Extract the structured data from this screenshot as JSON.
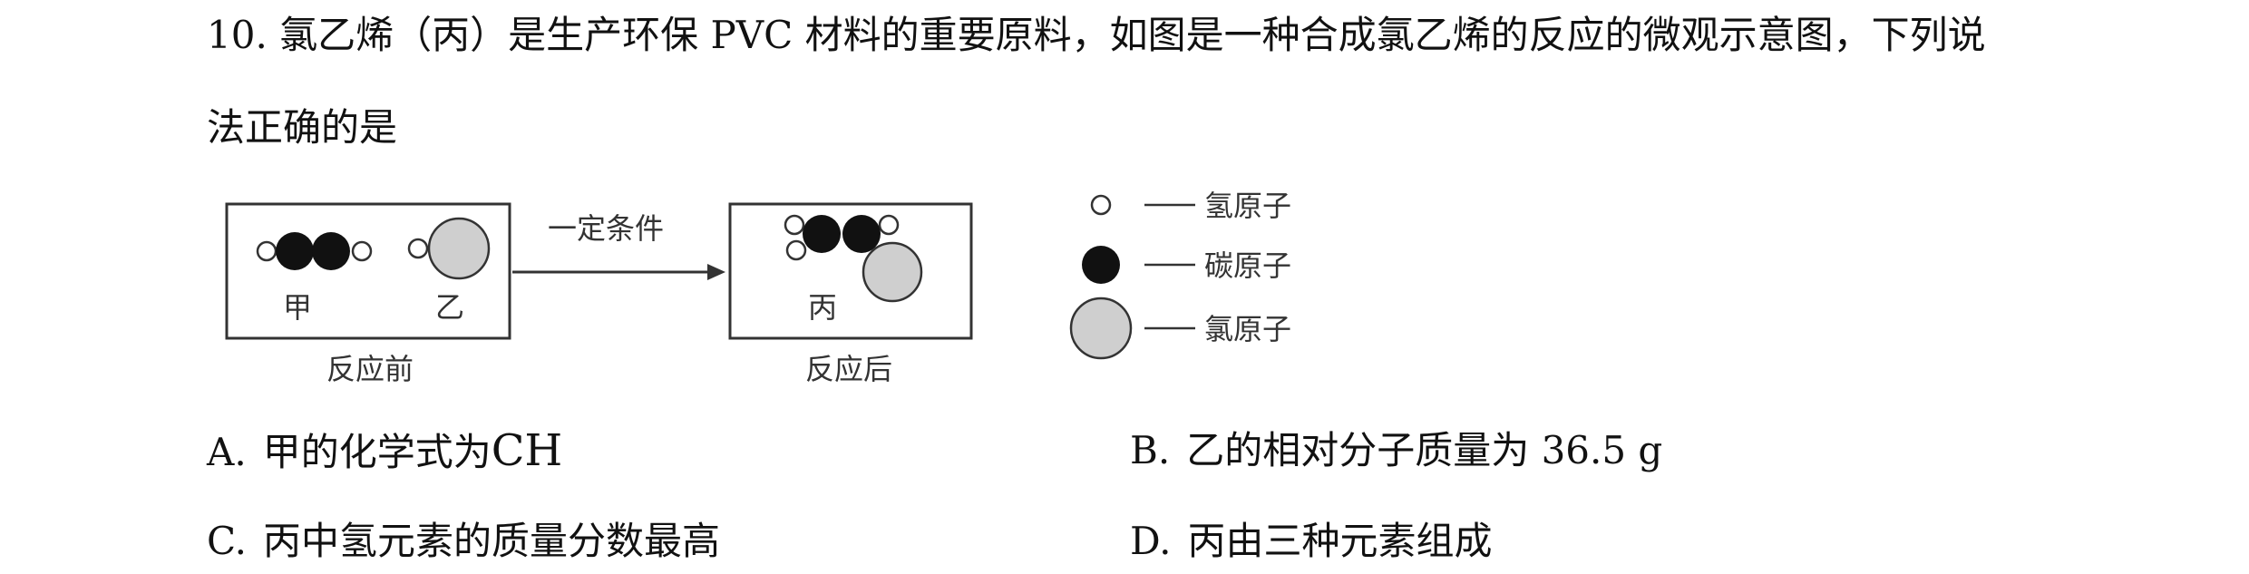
{
  "question": {
    "stem_line1": "10. 氯乙烯（丙）是生产环保 PVC 材料的重要原料，如图是一种合成氯乙烯的反应的微观示意图，下列说",
    "stem_line2": "法正确的是"
  },
  "diagram": {
    "reactants_box": {
      "label_jia": "甲",
      "label_yi": "乙",
      "caption": "反应前"
    },
    "arrow_label": "一定条件",
    "products_box": {
      "label_bing": "丙",
      "caption": "反应后"
    },
    "legend": [
      {
        "atom": "hydrogen",
        "label": "氢原子"
      },
      {
        "atom": "carbon",
        "label": "碳原子"
      },
      {
        "atom": "chlorine",
        "label": "氯原子"
      }
    ],
    "colors": {
      "hydrogen": "#ffffff",
      "carbon": "#111111",
      "chlorine": "#cfcfcf",
      "stroke": "#333333"
    }
  },
  "options": [
    {
      "letter": "A.",
      "text": "甲的化学式为",
      "formula": "CH"
    },
    {
      "letter": "B.",
      "text": "乙的相对分子质量为 36.5 g"
    },
    {
      "letter": "C.",
      "text": "丙中氢元素的质量分数最高"
    },
    {
      "letter": "D.",
      "text": "丙由三种元素组成"
    }
  ]
}
